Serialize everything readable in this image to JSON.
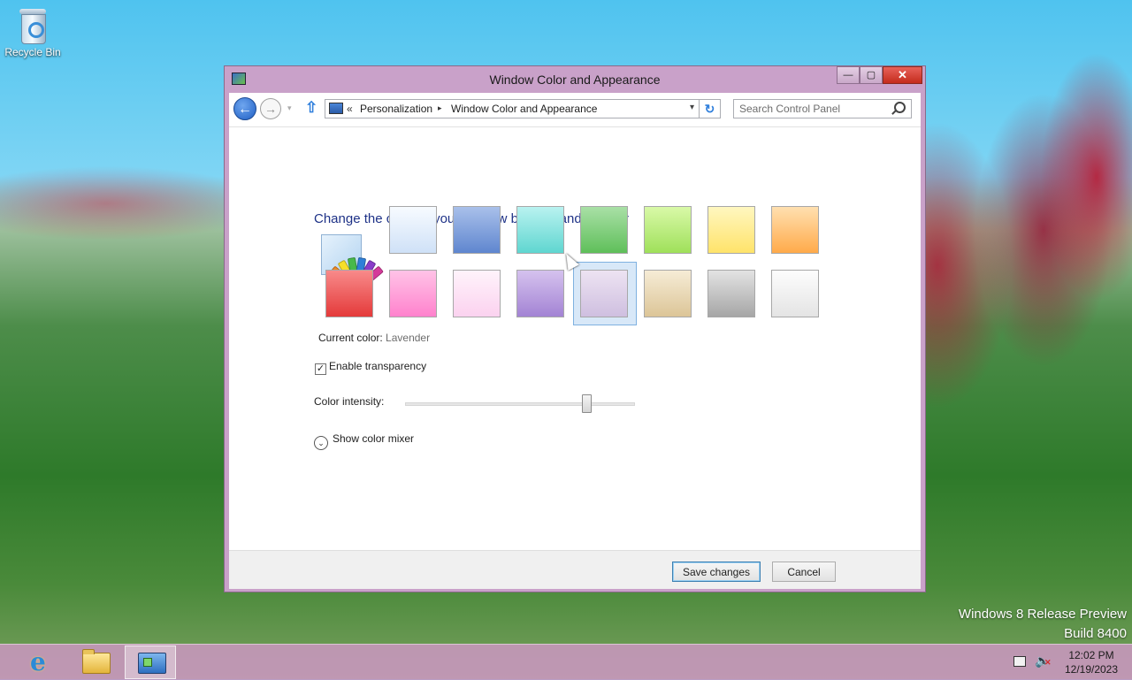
{
  "desktop": {
    "recycle_bin_label": "Recycle Bin",
    "watermark_line1": "Windows 8 Release Preview",
    "watermark_line2": "Build 8400"
  },
  "window": {
    "title": "Window Color and Appearance",
    "close_glyph": "✕",
    "minimize_glyph": "—",
    "maximize_glyph": "▢"
  },
  "navigation": {
    "back_glyph": "←",
    "forward_glyph": "→",
    "recent_glyph": "▾",
    "up_glyph": "⇧",
    "refresh_glyph": "↻",
    "address_prefix": "«",
    "breadcrumbs": [
      "Personalization",
      "Window Color and Appearance"
    ],
    "breadcrumb_separator": "▸",
    "dropdown_glyph": "▾",
    "search_placeholder": "Search Control Panel"
  },
  "content": {
    "heading": "Change the color of your window borders and taskbar",
    "current_color_label": "Current color:",
    "current_color_value": "Lavender",
    "enable_transparency_label": "Enable transparency",
    "enable_transparency_checked": true,
    "check_glyph": "✓",
    "color_intensity_label": "Color intensity:",
    "color_intensity_fraction": 0.79,
    "show_color_mixer_label": "Show color mixer",
    "mixer_glyph": "⌄"
  },
  "swatches": {
    "row1": [
      {
        "name": "sky",
        "from": "#f7fbff",
        "to": "#cfe1f7"
      },
      {
        "name": "twilight",
        "from": "#a9c0ea",
        "to": "#5f86cf"
      },
      {
        "name": "sea-foam",
        "from": "#b9f2f0",
        "to": "#5fd6d0"
      },
      {
        "name": "leaf",
        "from": "#a9e0a6",
        "to": "#5fbf5a"
      },
      {
        "name": "lime",
        "from": "#d9f9a8",
        "to": "#9fe05a"
      },
      {
        "name": "sun",
        "from": "#fff7c0",
        "to": "#ffe36a"
      },
      {
        "name": "pumpkin",
        "from": "#ffe0b0",
        "to": "#ffaa4a"
      }
    ],
    "row2": [
      {
        "name": "ruby",
        "from": "#f88a8a",
        "to": "#e43a3a"
      },
      {
        "name": "fuchsia",
        "from": "#ffc3e7",
        "to": "#ff82cd"
      },
      {
        "name": "blush",
        "from": "#fff3fb",
        "to": "#fbd2ef"
      },
      {
        "name": "violet",
        "from": "#d5c2ee",
        "to": "#a383d4"
      },
      {
        "name": "lavender",
        "from": "#ede3f2",
        "to": "#cfbfe0"
      },
      {
        "name": "taupe",
        "from": "#f6ecd6",
        "to": "#dcc597"
      },
      {
        "name": "chocolate",
        "from": "#e3e3e3",
        "to": "#a6a6a6"
      },
      {
        "name": "slate",
        "from": "#fdfdfd",
        "to": "#e4e4e4"
      }
    ],
    "selected": "lavender"
  },
  "buttons": {
    "save": "Save changes",
    "cancel": "Cancel"
  },
  "taskbar": {
    "time": "12:02 PM",
    "date": "12/19/2023",
    "ie_glyph": "e",
    "volume_glyph": "🔈",
    "mute_glyph": "✕"
  }
}
